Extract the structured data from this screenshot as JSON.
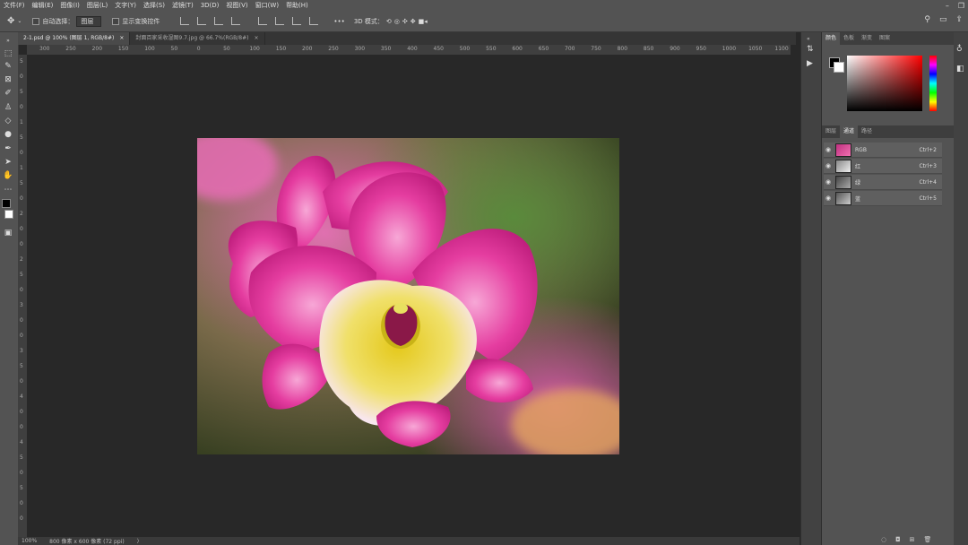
{
  "menu": [
    "文件(F)",
    "编辑(E)",
    "图像(I)",
    "图层(L)",
    "文字(Y)",
    "选择(S)",
    "滤镜(T)",
    "3D(D)",
    "视图(V)",
    "窗口(W)",
    "帮助(H)"
  ],
  "options": {
    "auto_select_label": "自动选择：",
    "auto_select_value": "图层",
    "show_transform_label": "显示变换控件",
    "more": "•••",
    "mode_3d_label": "3D 模式："
  },
  "tabs": [
    {
      "label": "2-1.psd @ 100% (图层 1, RGB/8#)",
      "close": "×"
    },
    {
      "label": "封面百家采收湿图9.7.jpg @ 66.7%(RGB/8#)",
      "close": "×"
    }
  ],
  "ruler_h": [
    "300",
    "250",
    "200",
    "150",
    "100",
    "50",
    "0",
    "50",
    "100",
    "150",
    "200",
    "250",
    "300",
    "350",
    "400",
    "450",
    "500",
    "550",
    "600",
    "650",
    "700",
    "750",
    "800",
    "850",
    "900",
    "950",
    "1000",
    "1050",
    "1100"
  ],
  "ruler_v": [
    "5",
    "0",
    "5",
    "0",
    "1",
    "5",
    "0",
    "1",
    "5",
    "0",
    "2",
    "0",
    "0",
    "2",
    "5",
    "0",
    "3",
    "0",
    "0",
    "3",
    "5",
    "0",
    "4",
    "0",
    "0",
    "4",
    "5",
    "0",
    "5",
    "0",
    "0"
  ],
  "status": {
    "zoom": "100%",
    "doc": "800 像素 x 600 像素 (72 ppi)",
    "arrow": "〉"
  },
  "color_panel": {
    "tabs": [
      "颜色",
      "色板",
      "渐变",
      "图案"
    ],
    "fg": "#000000",
    "bg": "#ffffff",
    "hue": "#ff0000"
  },
  "channels_panel": {
    "tabs": [
      "图层",
      "通道",
      "路径"
    ],
    "rows": [
      {
        "name": "RGB",
        "shortcut": "Ctrl+2"
      },
      {
        "name": "红",
        "shortcut": "Ctrl+3"
      },
      {
        "name": "绿",
        "shortcut": "Ctrl+4"
      },
      {
        "name": "蓝",
        "shortcut": "Ctrl+5"
      }
    ]
  }
}
